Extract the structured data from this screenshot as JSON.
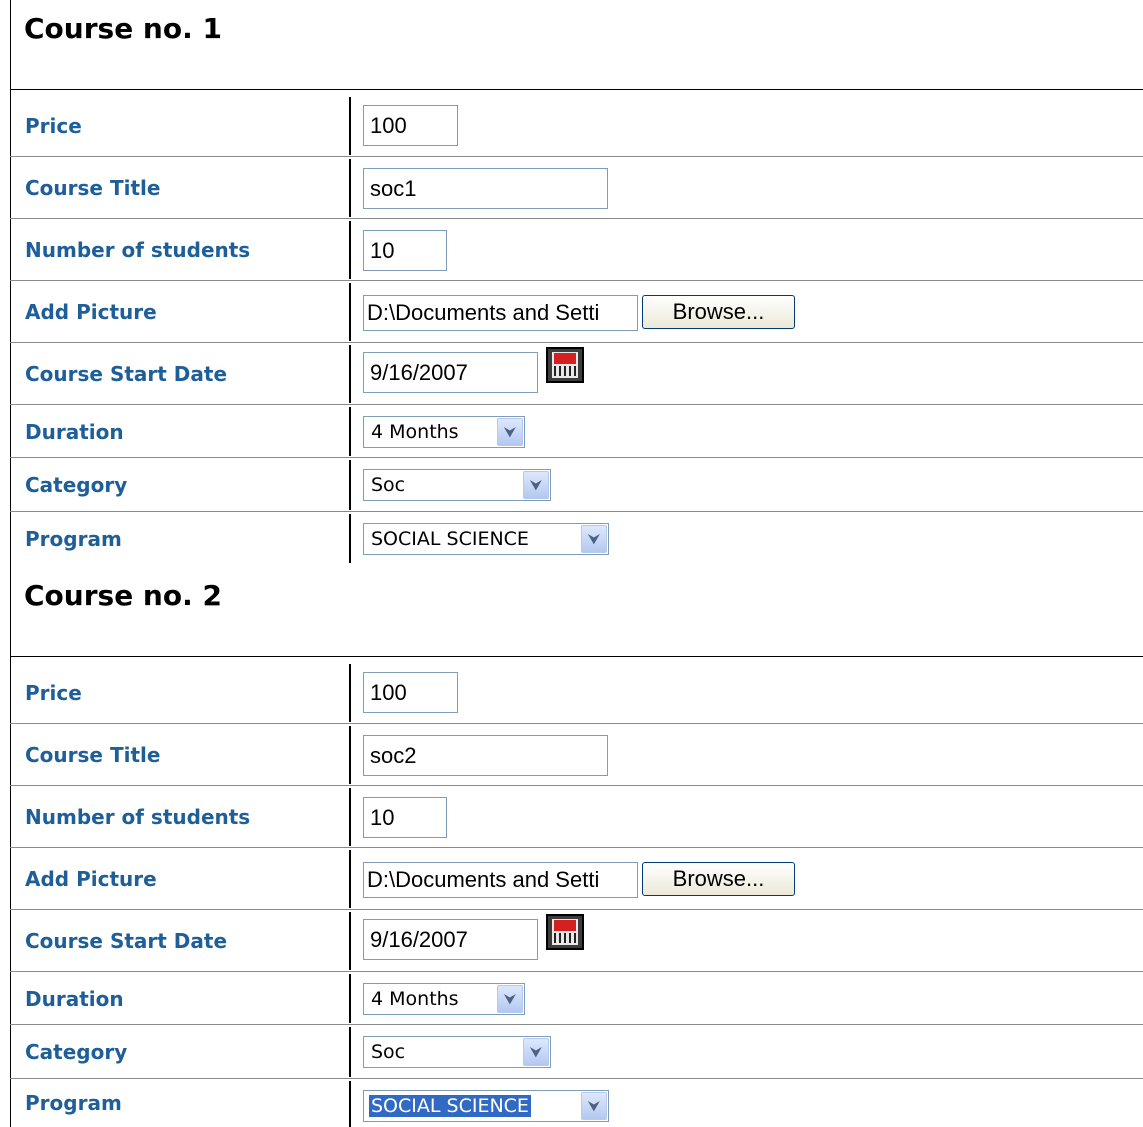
{
  "courses": [
    {
      "heading": "Course no. 1",
      "labels": {
        "price": "Price",
        "course_title": "Course Title",
        "number_of_students": "Number of students",
        "add_picture": "Add Picture",
        "course_start_date": "Course Start Date",
        "duration": "Duration",
        "category": "Category",
        "program": "Program"
      },
      "values": {
        "price": "100",
        "course_title": "soc1",
        "number_of_students": "10",
        "add_picture": "D:\\Documents and Setti",
        "course_start_date": "9/16/2007",
        "duration": "4 Months",
        "category": "Soc",
        "program": "SOCIAL SCIENCE"
      },
      "browse_label": "Browse...",
      "calendar_icon": "calendar-icon"
    },
    {
      "heading": "Course no. 2",
      "labels": {
        "price": "Price",
        "course_title": "Course Title",
        "number_of_students": "Number of students",
        "add_picture": "Add Picture",
        "course_start_date": "Course Start Date",
        "duration": "Duration",
        "category": "Category",
        "program": "Program"
      },
      "values": {
        "price": "100",
        "course_title": "soc2",
        "number_of_students": "10",
        "add_picture": "D:\\Documents and Setti",
        "course_start_date": "9/16/2007",
        "duration": "4 Months",
        "category": "Soc",
        "program": "SOCIAL SCIENCE"
      },
      "browse_label": "Browse...",
      "calendar_icon": "calendar-icon"
    }
  ],
  "colors": {
    "label_text": "#1f5f99",
    "input_border": "#7f9db9",
    "selected_highlight": "#316ac5"
  }
}
